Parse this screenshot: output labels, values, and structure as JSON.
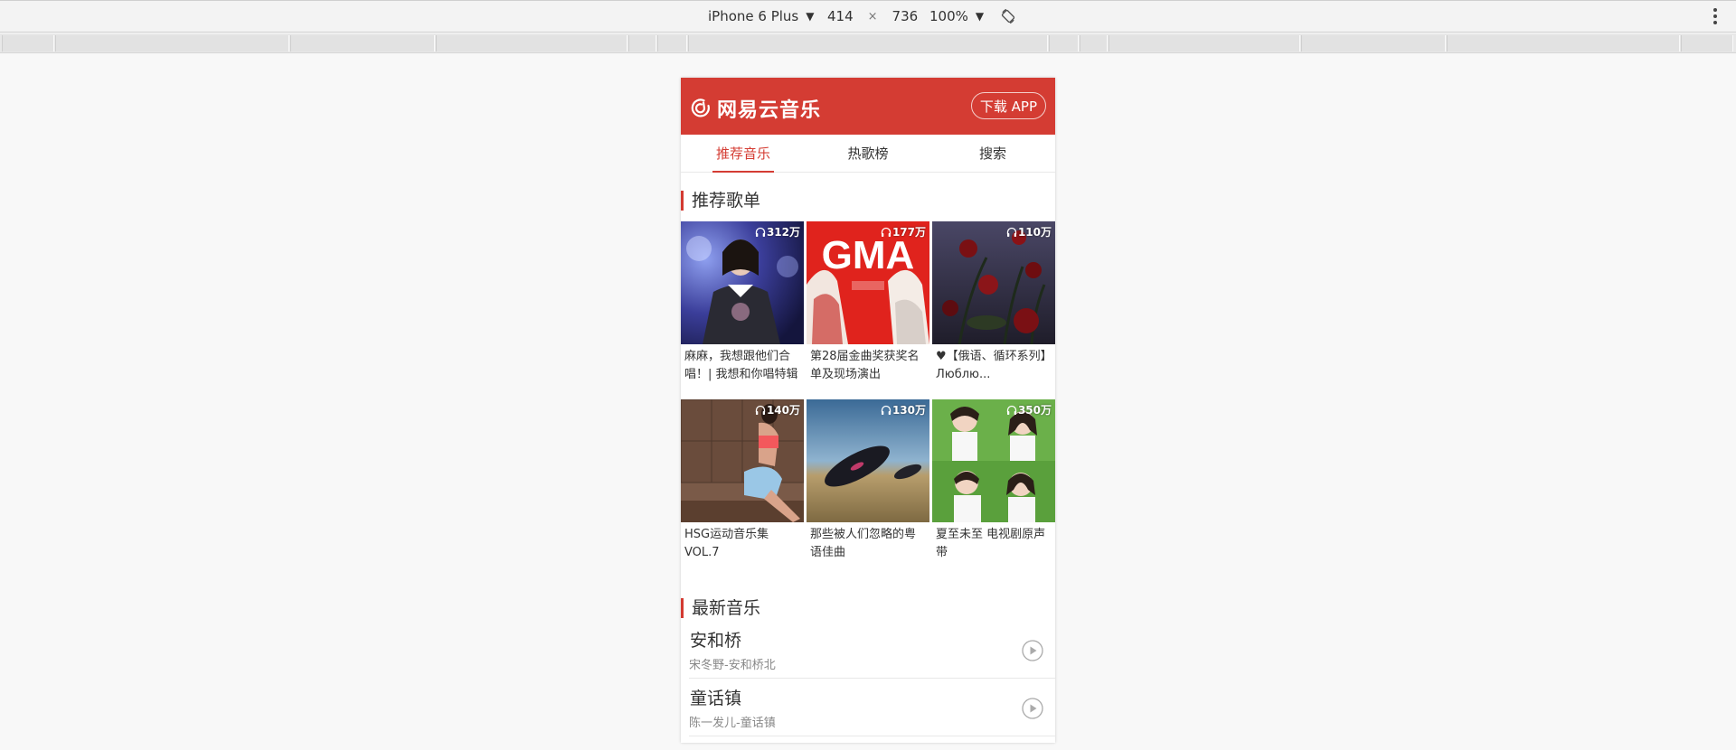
{
  "devtools": {
    "device": "iPhone 6 Plus",
    "width": "414",
    "times": "×",
    "height": "736",
    "zoom": "100%"
  },
  "app": {
    "brand": "网易云音乐",
    "download_btn": "下载 APP",
    "accent": "#d43c33"
  },
  "tabs": [
    {
      "label": "推荐音乐",
      "active": true
    },
    {
      "label": "热歌榜",
      "active": false
    },
    {
      "label": "搜索",
      "active": false
    }
  ],
  "recommend": {
    "title": "推荐歌单",
    "playlists": [
      {
        "count": "312万",
        "title": "麻麻，我想跟他们合唱！| 我想和你唱特辑"
      },
      {
        "count": "177万",
        "title": "第28届金曲奖获奖名单及现场演出"
      },
      {
        "count": "110万",
        "title": "♥【俄语、循环系列】Люблю..."
      },
      {
        "count": "140万",
        "title": "HSG运动音乐集 VOL.7"
      },
      {
        "count": "130万",
        "title": "那些被人们忽略的粤语佳曲"
      },
      {
        "count": "350万",
        "title": "夏至未至 电视剧原声带"
      }
    ]
  },
  "latest": {
    "title": "最新音乐",
    "songs": [
      {
        "name": "安和桥",
        "artist": "宋冬野-安和桥北"
      },
      {
        "name": "童话镇",
        "artist": "陈一发儿-童话镇"
      }
    ]
  }
}
